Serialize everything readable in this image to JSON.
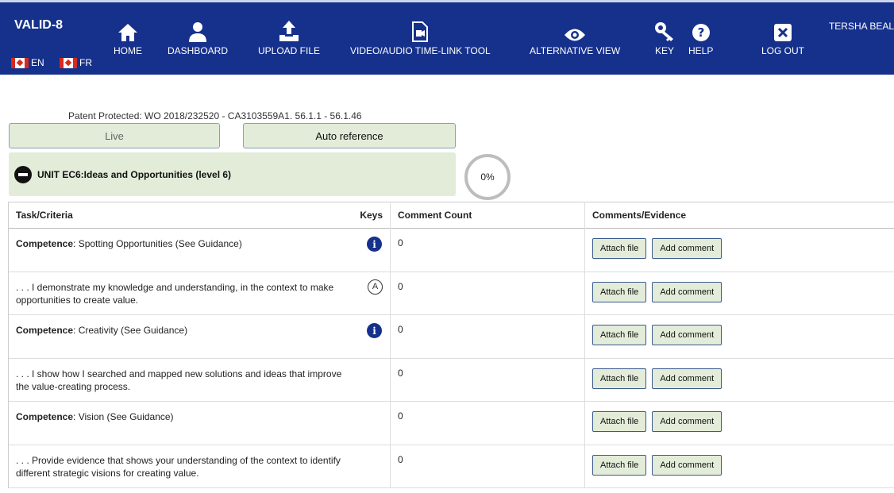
{
  "nav": {
    "brand": "VALID-8",
    "languages": [
      {
        "code": "EN"
      },
      {
        "code": "FR"
      }
    ],
    "items": [
      {
        "label": "HOME",
        "icon": "home-icon"
      },
      {
        "label": "DASHBOARD",
        "icon": "user-icon"
      },
      {
        "label": "UPLOAD FILE",
        "icon": "upload-icon"
      },
      {
        "label": "VIDEO/AUDIO TIME-LINK TOOL",
        "icon": "video-file-icon"
      },
      {
        "label": "ALTERNATIVE VIEW",
        "icon": "eye-icon"
      },
      {
        "label": "KEY",
        "icon": "key-icon"
      },
      {
        "label": "HELP",
        "icon": "help-icon"
      },
      {
        "label": "LOG OUT",
        "icon": "close-box-icon"
      }
    ],
    "user": "TERSHA BEAL"
  },
  "patent": "Patent Protected: WO 2018/232520 - CA3103559A1. 56.1.1 - 56.1.46",
  "tabs": {
    "live": "Live",
    "auto": "Auto reference"
  },
  "unit": {
    "title": "UNIT EC6:Ideas and Opportunities (level 6)",
    "progress": "0%"
  },
  "table": {
    "headers": {
      "task": "Task/Criteria",
      "keys": "Keys",
      "count": "Comment Count",
      "evidence": "Comments/Evidence"
    },
    "attach_label": "Attach file",
    "comment_label": "Add comment",
    "rows": [
      {
        "prefix": "Competence",
        "text": ": Spotting Opportunities (See Guidance)",
        "key": "info",
        "count": "0"
      },
      {
        "prefix": "",
        "text": ". . . I demonstrate my knowledge and understanding, in the context to make opportunities to create value.",
        "key": "A",
        "count": "0"
      },
      {
        "prefix": "Competence",
        "text": ": Creativity (See Guidance)",
        "key": "info",
        "count": "0"
      },
      {
        "prefix": "",
        "text": ". . . I show how I searched and mapped new solutions and ideas that improve the value-creating process.",
        "key": "",
        "count": "0"
      },
      {
        "prefix": "Competence",
        "text": ": Vision (See Guidance)",
        "key": "",
        "count": "0"
      },
      {
        "prefix": "",
        "text": ". . . Provide evidence that shows your understanding of the context to identify different strategic visions for creating value.",
        "key": "",
        "count": "0"
      }
    ]
  }
}
